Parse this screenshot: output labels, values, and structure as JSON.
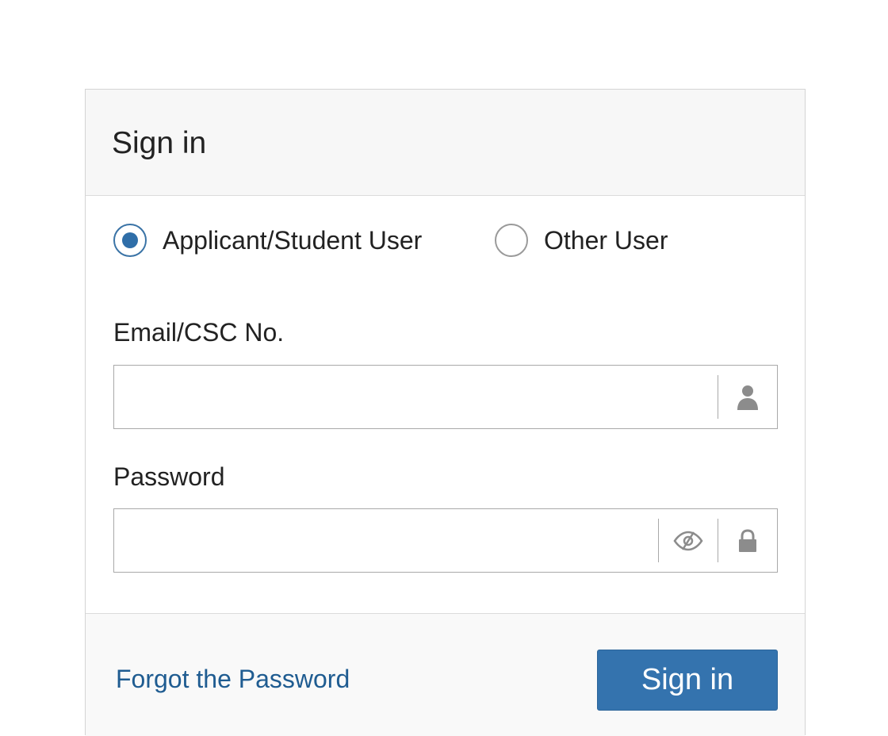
{
  "header": {
    "title": "Sign in"
  },
  "user_type": {
    "options": [
      {
        "label": "Applicant/Student User",
        "selected": true
      },
      {
        "label": "Other User",
        "selected": false
      }
    ]
  },
  "email": {
    "label": "Email/CSC No.",
    "value": "",
    "placeholder": "",
    "icon": "user-icon"
  },
  "password": {
    "label": "Password",
    "value": "",
    "placeholder": "",
    "toggle_icon": "eye-slash-icon",
    "icon": "lock-icon"
  },
  "footer": {
    "forgot_label": "Forgot the Password",
    "signin_label": "Sign in"
  },
  "colors": {
    "accent": "#3473ae",
    "link": "#1f5c91",
    "icon": "#8c8c8c"
  }
}
